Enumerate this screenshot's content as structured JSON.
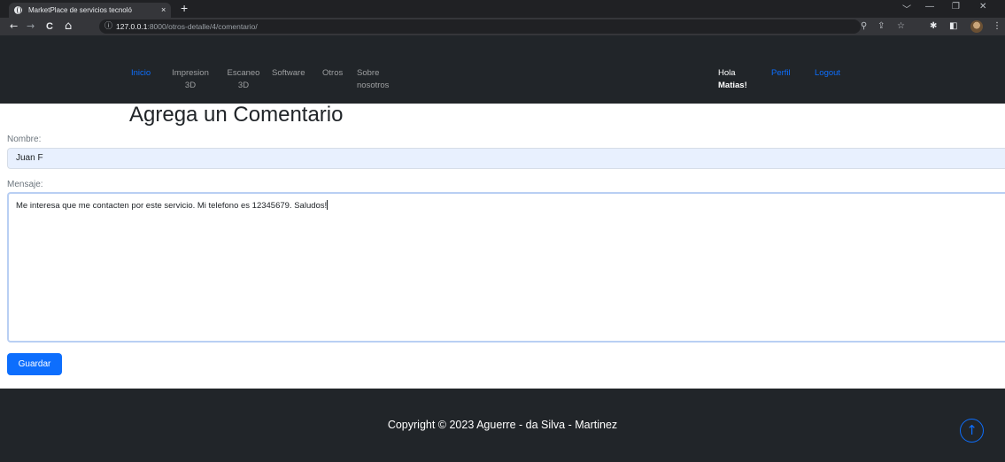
{
  "browser": {
    "tab_title": "MarketPlace de servicios tecnoló",
    "tab_close": "×",
    "new_tab": "+",
    "window_controls": {
      "chevron": "﹀",
      "minimize": "—",
      "restore": "❐",
      "close": "✕"
    },
    "nav": {
      "back": "←",
      "forward": "→",
      "reload": "C",
      "home": "⌂"
    },
    "address": {
      "info_icon": "ⓘ",
      "host": "127.0.0.1",
      "path": ":8000/otros-detalle/4/comentario/"
    },
    "toolbar_icons": {
      "zoom": "⚲",
      "share": "⇪",
      "star": "☆",
      "extensions": "✱",
      "sidebar": "◧",
      "menu": "⋮"
    }
  },
  "nav": {
    "items": [
      {
        "label": "Inicio",
        "active": true
      },
      {
        "label": "Impresion 3D"
      },
      {
        "label": "Escaneo 3D"
      },
      {
        "label": "Software"
      },
      {
        "label": "Otros"
      },
      {
        "label": "Sobre nosotros"
      }
    ],
    "greeting": "Hola",
    "user": "Matias!",
    "profile": "Perfil",
    "logout": "Logout"
  },
  "form": {
    "heading": "Agrega un Comentario",
    "name_label": "Nombre:",
    "name_value": "Juan F",
    "message_label": "Mensaje:",
    "message_value": "Me interesa que me contacten por este servicio. Mi telefono es 12345679. Saludos!",
    "submit": "Guardar"
  },
  "footer": {
    "copyright": "Copyright © 2023 Aguerre - da Silva - Martinez",
    "to_top": "↑"
  },
  "colors": {
    "primary": "#0d6efd",
    "dark": "#212529",
    "input_autofill": "#e8f0fe"
  }
}
